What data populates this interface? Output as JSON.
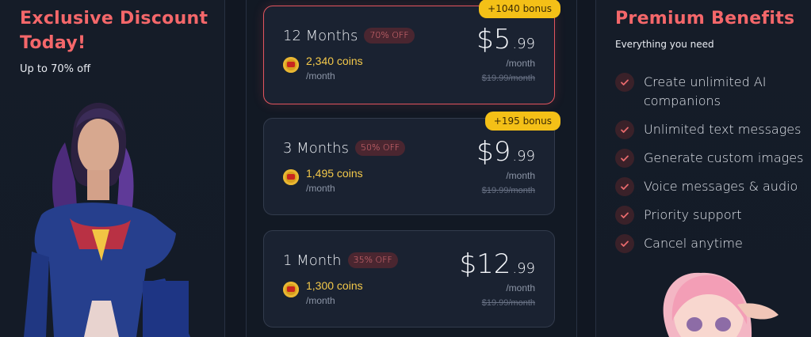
{
  "promo": {
    "title": "Exclusive Discount Today!",
    "subtitle": "Up to 70% off"
  },
  "plans": [
    {
      "name": "12 Months",
      "discount": "70% OFF",
      "bonus": "+1040 bonus",
      "coins": "2,340 coins",
      "coins_unit": "/month",
      "price_main": "$5",
      "price_cents": ".99",
      "price_unit": "/month",
      "original": "$19.99/month"
    },
    {
      "name": "3 Months",
      "discount": "50% OFF",
      "bonus": "+195 bonus",
      "coins": "1,495 coins",
      "coins_unit": "/month",
      "price_main": "$9",
      "price_cents": ".99",
      "price_unit": "/month",
      "original": "$19.99/month"
    },
    {
      "name": "1 Month",
      "discount": "35% OFF",
      "coins": "1,300 coins",
      "coins_unit": "/month",
      "price_main": "$12",
      "price_cents": ".99",
      "price_unit": "/month",
      "original": "$19.99/month"
    }
  ],
  "benefits": {
    "title": "Premium Benefits",
    "subtitle": "Everything you need",
    "items": [
      "Create unlimited AI companions",
      "Unlimited text messages",
      "Generate custom images",
      "Voice messages & audio",
      "Priority support",
      "Cancel anytime"
    ]
  },
  "colors": {
    "accent": "#f4676a",
    "bonus": "#f4c017",
    "coin_text": "#f4c94a"
  },
  "icons": {
    "check": "check-icon",
    "coin": "coin-icon"
  }
}
